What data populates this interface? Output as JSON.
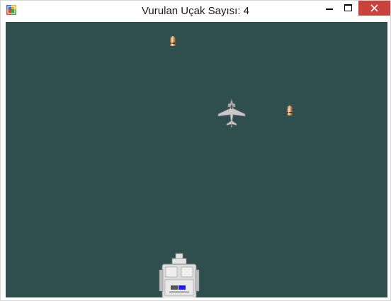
{
  "window": {
    "title": "Vurulan Uçak Sayısı: 4",
    "icons": [
      "app-icon",
      "minimize-icon",
      "maximize-icon",
      "close-icon"
    ]
  },
  "game": {
    "background_color": "#2f4f4f",
    "sprites": [
      "bullet",
      "bullet",
      "enemy-jet",
      "player-ship"
    ]
  }
}
